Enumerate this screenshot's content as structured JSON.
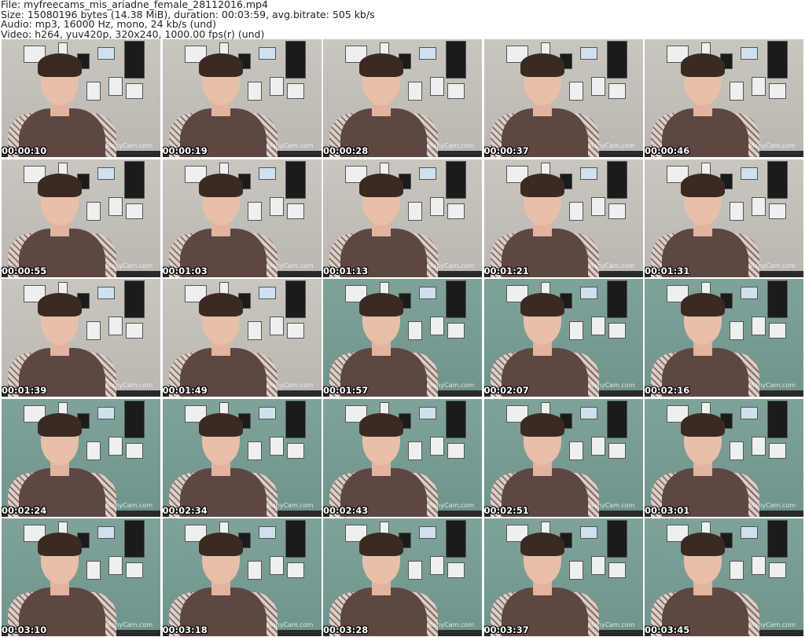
{
  "header": {
    "file": "File: myfreecams_mis_ariadne_female_28112016.mp4",
    "size": "Size: 15080196 bytes (14.38 MiB), duration: 00:03:59, avg.bitrate: 505 kb/s",
    "audio": "Audio: mp3, 16000 Hz, mono, 24 kb/s (und)",
    "video": "Video: h264, yuv420p, 320x240, 1000.00 fps(r) (und)"
  },
  "watermark": "ManyCam.com",
  "thumbnails": [
    {
      "timestamp": "00:00:10",
      "tone": "grey"
    },
    {
      "timestamp": "00:00:19",
      "tone": "grey"
    },
    {
      "timestamp": "00:00:28",
      "tone": "grey"
    },
    {
      "timestamp": "00:00:37",
      "tone": "grey"
    },
    {
      "timestamp": "00:00:46",
      "tone": "grey"
    },
    {
      "timestamp": "00:00:55",
      "tone": "grey"
    },
    {
      "timestamp": "00:01:03",
      "tone": "grey"
    },
    {
      "timestamp": "00:01:13",
      "tone": "grey"
    },
    {
      "timestamp": "00:01:21",
      "tone": "grey"
    },
    {
      "timestamp": "00:01:31",
      "tone": "grey"
    },
    {
      "timestamp": "00:01:39",
      "tone": "grey"
    },
    {
      "timestamp": "00:01:49",
      "tone": "grey"
    },
    {
      "timestamp": "00:01:57",
      "tone": "green"
    },
    {
      "timestamp": "00:02:07",
      "tone": "green"
    },
    {
      "timestamp": "00:02:16",
      "tone": "green"
    },
    {
      "timestamp": "00:02:24",
      "tone": "green"
    },
    {
      "timestamp": "00:02:34",
      "tone": "green"
    },
    {
      "timestamp": "00:02:43",
      "tone": "green"
    },
    {
      "timestamp": "00:02:51",
      "tone": "green"
    },
    {
      "timestamp": "00:03:01",
      "tone": "green"
    },
    {
      "timestamp": "00:03:10",
      "tone": "green"
    },
    {
      "timestamp": "00:03:18",
      "tone": "green"
    },
    {
      "timestamp": "00:03:28",
      "tone": "green"
    },
    {
      "timestamp": "00:03:37",
      "tone": "green"
    },
    {
      "timestamp": "00:03:45",
      "tone": "green"
    }
  ]
}
